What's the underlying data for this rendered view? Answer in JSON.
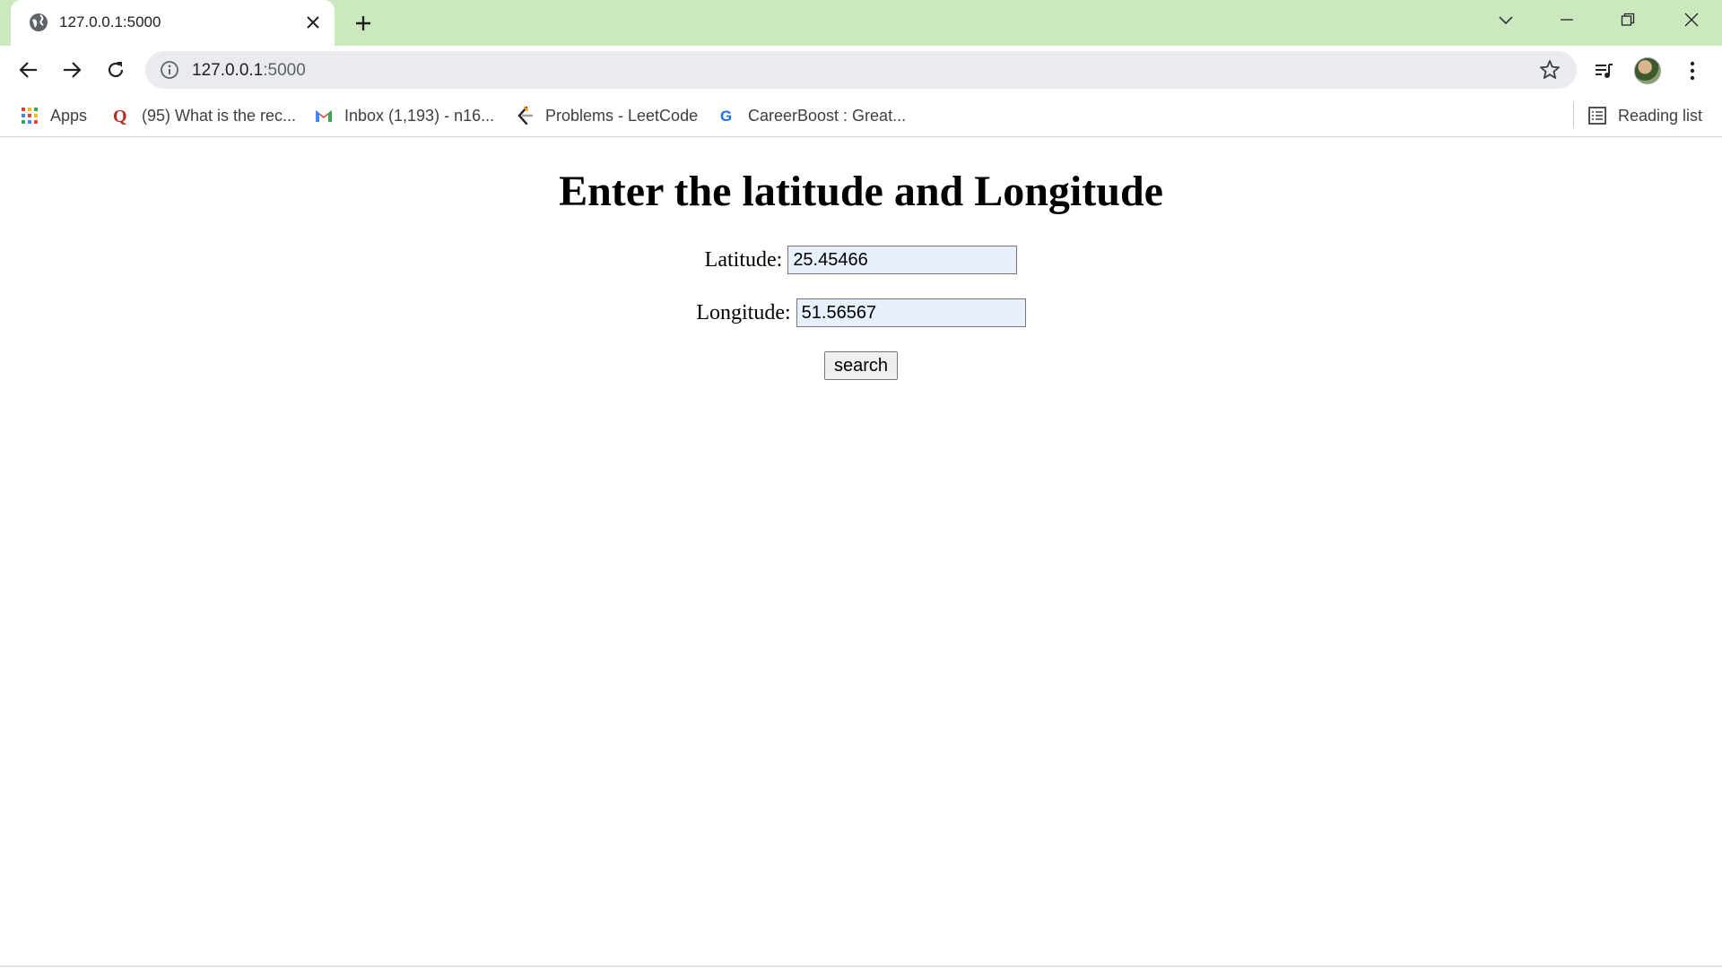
{
  "browser": {
    "tab": {
      "title": "127.0.0.1:5000"
    },
    "address_bar": {
      "host": "127.0.0.1",
      "port": ":5000"
    },
    "bookmarks": [
      {
        "label": "Apps",
        "icon": "apps-grid-icon"
      },
      {
        "label": "(95) What is the rec...",
        "icon": "quora-icon"
      },
      {
        "label": "Inbox (1,193) - n16...",
        "icon": "gmail-icon"
      },
      {
        "label": "Problems - LeetCode",
        "icon": "leetcode-icon"
      },
      {
        "label": "CareerBoost : Great...",
        "icon": "google-icon"
      }
    ],
    "reading_list": "Reading list"
  },
  "page": {
    "title": "Enter the latitude and Longitude",
    "latitude": {
      "label": "Latitude:",
      "value": "25.45466"
    },
    "longitude": {
      "label": "Longitude:",
      "value": "51.56567"
    },
    "search_button": "search"
  },
  "colors": {
    "tabstrip": "#cce8bf",
    "omnibox": "#e9ebee",
    "autofill": "#e8f0fe"
  }
}
